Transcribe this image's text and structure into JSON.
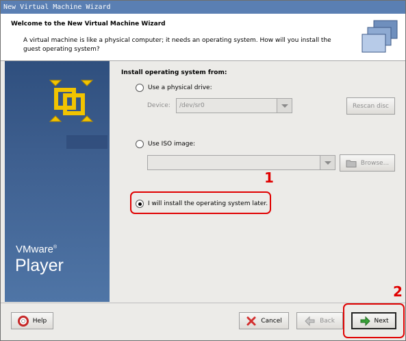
{
  "window": {
    "title": "New Virtual Machine Wizard"
  },
  "header": {
    "title": "Welcome to the New Virtual Machine Wizard",
    "subtitle": "A virtual machine is like a physical computer; it needs an operating system. How will you install the guest operating system?"
  },
  "sidebar": {
    "brand_vmware": "VMware",
    "brand_reg": "®",
    "brand_player": "Player"
  },
  "install": {
    "section_title": "Install operating system from:",
    "physical_drive": {
      "label": "Use a physical drive:",
      "device_label": "Device:",
      "device_value": "/dev/sr0",
      "rescan_label": "Rescan disc"
    },
    "iso": {
      "label": "Use ISO image:",
      "value": "",
      "browse_label": "Browse..."
    },
    "later": {
      "label": "I will install the operating system later.",
      "selected": true
    }
  },
  "footer": {
    "help_label": "Help",
    "cancel_label": "Cancel",
    "back_label": "Back",
    "next_label": "Next"
  },
  "annotations": {
    "step1": "1",
    "step2": "2"
  },
  "colors": {
    "annotation": "#e00000",
    "sidebar": "#3e5f8f",
    "titlebar": "#5a7fb3"
  }
}
